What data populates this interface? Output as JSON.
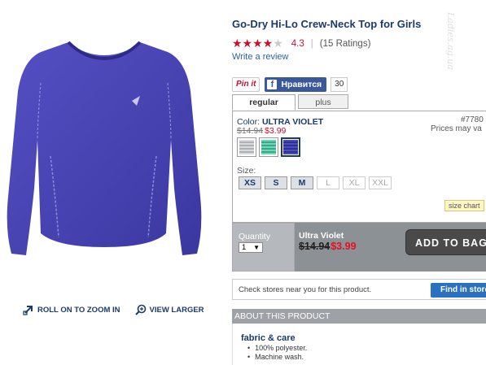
{
  "product": {
    "title": "Go-Dry Hi-Lo Crew-Neck Top for Girls",
    "rating_value": "4.3",
    "rating_stars": "★★★★",
    "rating_empty": "★",
    "rating_count": "(15 Ratings)",
    "rating_sep": "|",
    "write_review": "Write a review"
  },
  "image": {
    "zoom_label": "ROLL ON TO ZOOM IN",
    "larger_label": "VIEW LARGER"
  },
  "social": {
    "pinit": "Pin it",
    "fb_icon": "f",
    "fb_label": "Нравится",
    "fb_count": "30"
  },
  "tabs": [
    {
      "label": "regular"
    },
    {
      "label": "plus"
    }
  ],
  "config": {
    "color_prefix": "Color:",
    "color_name": "ULTRA VIOLET",
    "sku": "#7780",
    "prices_vary": "Prices may va",
    "was_price": "$14.94",
    "now_price": "$3.99",
    "swatches": [
      {
        "name": "grey",
        "color": "#c9ccd0"
      },
      {
        "name": "mint",
        "color": "#4fc9a7"
      },
      {
        "name": "ultra-violet",
        "color": "#3d3fa8"
      }
    ],
    "size_label": "Size:",
    "sizes": [
      {
        "label": "XS",
        "available": true
      },
      {
        "label": "S",
        "available": true
      },
      {
        "label": "M",
        "available": true
      },
      {
        "label": "L",
        "available": false
      },
      {
        "label": "XL",
        "available": false
      },
      {
        "label": "XXL",
        "available": false
      }
    ],
    "size_chart": "size chart"
  },
  "cart": {
    "qty_label": "Quantity",
    "qty_value": "1",
    "qty_arrow": "▼",
    "item_name": "Ultra Violet",
    "was_price": "$14.94",
    "now_price": "$3.99",
    "add_button": "ADD TO BAG"
  },
  "stores": {
    "text": "Check stores near you for this product.",
    "button": "Find in store"
  },
  "about": {
    "header": "ABOUT THIS PRODUCT",
    "fabric_title": "fabric & care",
    "items": [
      "100% polyester.",
      "Machine wash."
    ]
  },
  "watermark": "Ladies.ag.ua",
  "colors": {
    "brand_navy": "#1a3a6b",
    "sale_red": "#c8102e",
    "shirt": "#4a46b4"
  }
}
